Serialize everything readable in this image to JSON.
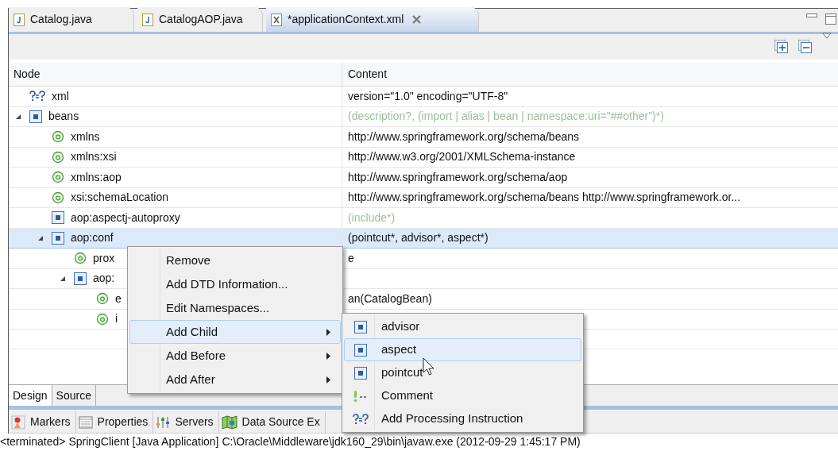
{
  "editor_tabs": [
    {
      "label": "Catalog.java",
      "kind": "java",
      "selected": false,
      "closable": false
    },
    {
      "label": "CatalogAOP.java",
      "kind": "java",
      "selected": false,
      "closable": false
    },
    {
      "label": "*applicationContext.xml",
      "kind": "xml",
      "selected": true,
      "closable": true
    }
  ],
  "table": {
    "columns": [
      "Node",
      "Content"
    ],
    "rows": [
      {
        "kind": "pi",
        "name": "xml",
        "content": "version=\"1.0\" encoding=\"UTF-8\"",
        "grammar": false,
        "selected": false
      },
      {
        "kind": "element",
        "name": "beans",
        "content": "(description?, (import | alias | bean | namespace:uri=\"##other\")*)",
        "grammar": true,
        "selected": false,
        "expanded": true,
        "children": [
          {
            "kind": "attribute",
            "name": "xmlns",
            "content": "http://www.springframework.org/schema/beans",
            "grammar": false,
            "selected": false
          },
          {
            "kind": "attribute",
            "name": "xmlns:xsi",
            "content": "http://www.w3.org/2001/XMLSchema-instance",
            "grammar": false,
            "selected": false
          },
          {
            "kind": "attribute",
            "name": "xmlns:aop",
            "content": "http://www.springframework.org/schema/aop",
            "grammar": false,
            "selected": false
          },
          {
            "kind": "attribute",
            "name": "xsi:schemaLocation",
            "content": "http://www.springframework.org/schema/beans http://www.springframework.or...",
            "grammar": false,
            "selected": false
          },
          {
            "kind": "element",
            "name": "aop:aspectj-autoproxy",
            "content": "(include*)",
            "grammar": true,
            "selected": false
          },
          {
            "kind": "element",
            "name": "aop:conf",
            "content": "(pointcut*, advisor*, aspect*)",
            "grammar": false,
            "selected": true,
            "expanded": true,
            "children": [
              {
                "kind": "attribute",
                "name": "prox",
                "content": "e",
                "grammar": false,
                "selected": false
              },
              {
                "kind": "element",
                "name": "aop:",
                "selected": false,
                "expanded": true,
                "children": [
                  {
                    "kind": "attribute",
                    "name": "e",
                    "content": "an(CatalogBean)",
                    "grammar": false,
                    "selected": false
                  },
                  {
                    "kind": "attribute",
                    "name": "i",
                    "selected": false
                  }
                ]
              }
            ]
          }
        ]
      }
    ]
  },
  "view_tabs": [
    {
      "label": "Design",
      "selected": true
    },
    {
      "label": "Source",
      "selected": false
    }
  ],
  "context_menu": {
    "items": [
      {
        "label": "Remove",
        "submenu": false,
        "selected": false
      },
      {
        "label": "Add DTD Information...",
        "submenu": false,
        "selected": false
      },
      {
        "label": "Edit Namespaces...",
        "submenu": false,
        "selected": false
      },
      {
        "label": "Add Child",
        "submenu": true,
        "selected": true
      },
      {
        "label": "Add Before",
        "submenu": true,
        "selected": false
      },
      {
        "label": "Add After",
        "submenu": true,
        "selected": false
      }
    ]
  },
  "submenu": {
    "items": [
      {
        "label": "advisor",
        "kind": "element",
        "selected": false
      },
      {
        "label": "aspect",
        "kind": "element",
        "selected": true
      },
      {
        "label": "pointcut",
        "kind": "element",
        "selected": false
      },
      {
        "label": "Comment",
        "kind": "comment",
        "selected": false
      },
      {
        "label": "Add Processing Instruction",
        "kind": "pi",
        "selected": false
      }
    ]
  },
  "panel_tabs": [
    {
      "label": "Markers",
      "kind": "markers"
    },
    {
      "label": "Properties",
      "kind": "properties"
    },
    {
      "label": "Servers",
      "kind": "servers"
    },
    {
      "label": "Data Source Ex",
      "kind": "datasource"
    }
  ],
  "console": {
    "text": "<terminated> SpringClient [Java Application] C:\\Oracle\\Middleware\\jdk160_29\\bin\\javaw.exe (2012-09-29 1:45:17 PM)"
  }
}
